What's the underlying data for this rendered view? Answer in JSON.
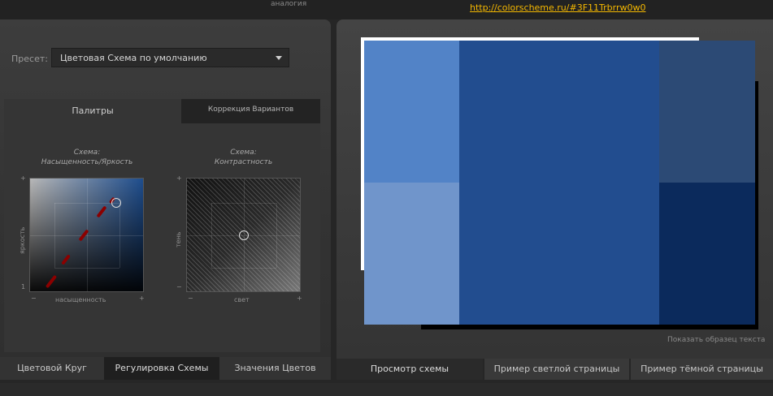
{
  "header": {
    "mode_label": "аналогия",
    "scheme_url": "http://colorscheme.ru/#3F11Trbrrw0w0"
  },
  "settings": {
    "preset_label": "Пресет:",
    "preset_value": "Цветовая Схема по умолчанию",
    "tabs": {
      "palettes": "Палитры",
      "variants": "Коррекция Вариантов"
    },
    "sat_title_line1": "Схема:",
    "sat_title_line2": "Насыщенность/Яркость",
    "contrast_title_line1": "Схема:",
    "contrast_title_line2": "Контрастность",
    "sat_y_axis": "яркость",
    "sat_x_axis": "насыщенность",
    "contrast_y_axis": "тень",
    "contrast_x_axis": "свет",
    "plus": "+",
    "minus": "−",
    "one": "1"
  },
  "left_tabs": {
    "color_wheel": "Цветовой Круг",
    "adjust_scheme": "Регулировка Схемы",
    "color_values": "Значения Цветов"
  },
  "preview": {
    "colors": {
      "swatch_top_left": "#5283c7",
      "swatch_bottom_left": "#7095cb",
      "swatch_center": "#224d8f",
      "swatch_top_right": "#2c4a75",
      "swatch_bottom_right": "#0b2a5c"
    },
    "sample_text": "Показать образец текста"
  },
  "right_tabs": {
    "scheme_view": "Просмотр схемы",
    "light_page": "Пример светлой страницы",
    "dark_page": "Пример тёмной страницы"
  }
}
